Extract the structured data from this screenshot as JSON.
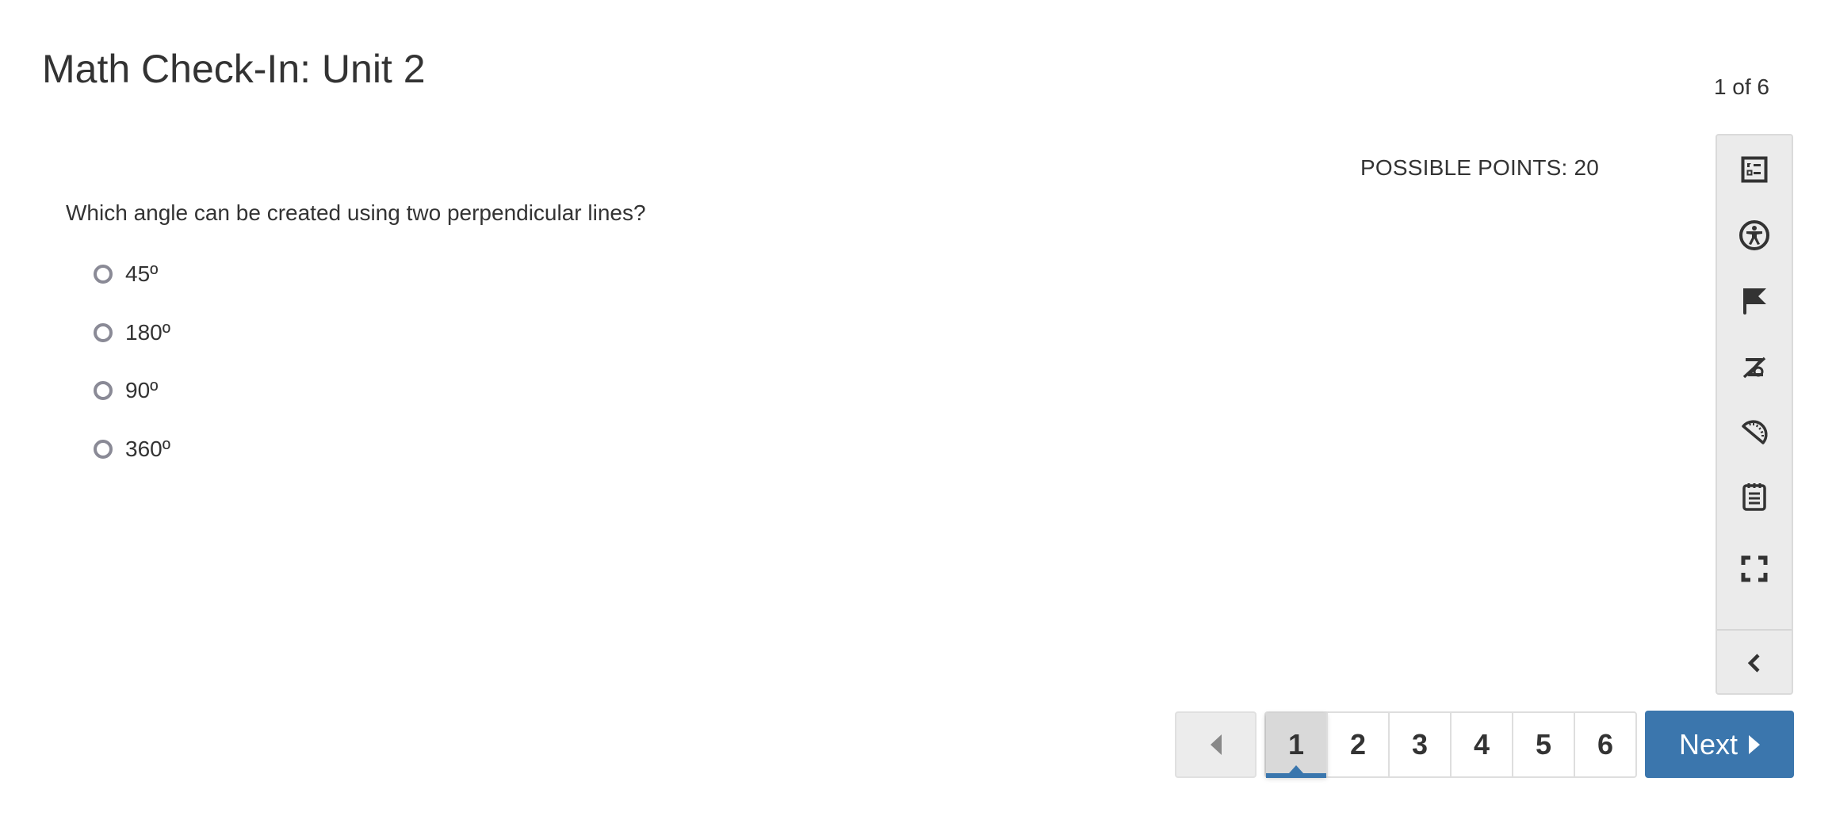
{
  "header": {
    "title": "Math Check-In: Unit 2",
    "progress_text": "1 of 6"
  },
  "question": {
    "possible_points": "POSSIBLE POINTS: 20",
    "prompt": "Which angle can be created using two perpendicular lines?",
    "options": [
      {
        "label": "45º",
        "selected": false
      },
      {
        "label": "180º",
        "selected": false
      },
      {
        "label": "90º",
        "selected": false
      },
      {
        "label": "360º",
        "selected": false
      }
    ]
  },
  "toolbar": {
    "tools": [
      {
        "icon": "answer-eliminator-icon"
      },
      {
        "icon": "accessibility-icon"
      },
      {
        "icon": "flag-icon"
      },
      {
        "icon": "text-to-speech-off-icon"
      },
      {
        "icon": "protractor-icon"
      },
      {
        "icon": "notepad-icon"
      },
      {
        "icon": "fullscreen-icon"
      }
    ],
    "collapse_icon": "chevron-left-icon"
  },
  "pagination": {
    "prev_icon": "caret-left-icon",
    "pages": [
      "1",
      "2",
      "3",
      "4",
      "5",
      "6"
    ],
    "current_page": "1",
    "next_label": "Next",
    "next_icon": "caret-right-icon"
  },
  "colors": {
    "accent": "#3b76ad",
    "text": "#333333",
    "sidebar_bg": "#ebebeb",
    "radio_border": "#8a8a96"
  }
}
